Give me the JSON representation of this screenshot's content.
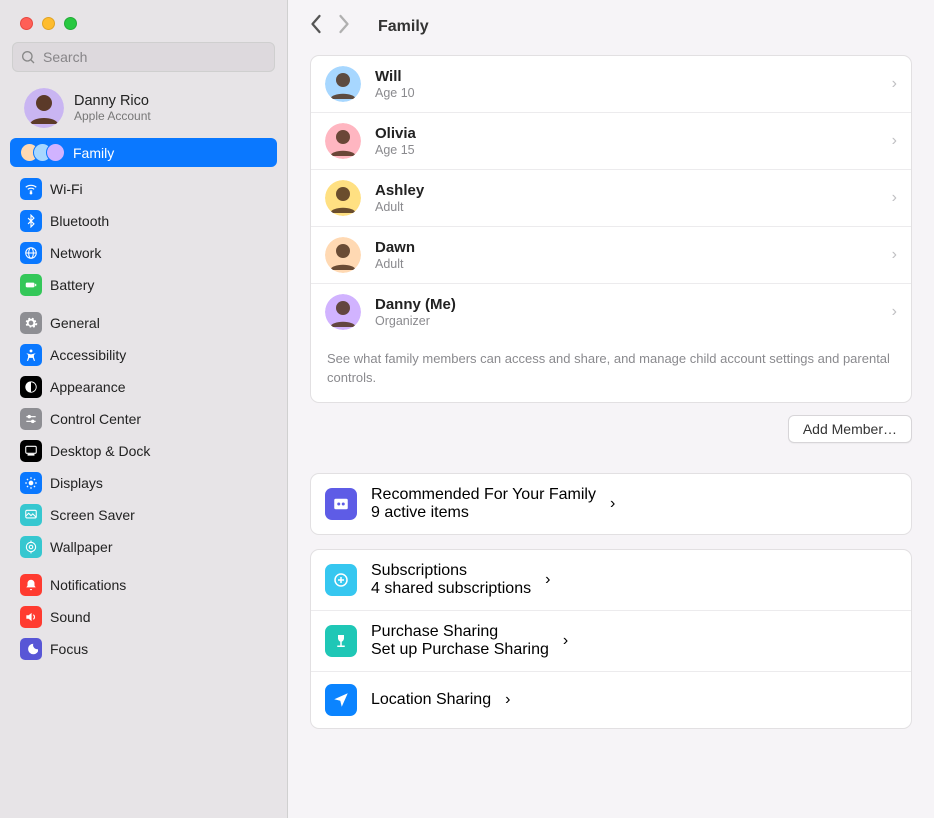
{
  "search": {
    "placeholder": "Search"
  },
  "account": {
    "name": "Danny Rico",
    "subtitle": "Apple Account"
  },
  "sidebar": {
    "itemsTop": [
      {
        "label": "Family",
        "icon": "family-icon",
        "selected": true
      }
    ],
    "group1": [
      {
        "label": "Wi-Fi",
        "icon": "wifi-icon",
        "bg": "#0a78ff"
      },
      {
        "label": "Bluetooth",
        "icon": "bluetooth-icon",
        "bg": "#0a78ff"
      },
      {
        "label": "Network",
        "icon": "network-icon",
        "bg": "#0a78ff"
      },
      {
        "label": "Battery",
        "icon": "battery-icon",
        "bg": "#34c759"
      }
    ],
    "group2": [
      {
        "label": "General",
        "icon": "gear-icon",
        "bg": "#8e8e93"
      },
      {
        "label": "Accessibility",
        "icon": "accessibility-icon",
        "bg": "#0a78ff"
      },
      {
        "label": "Appearance",
        "icon": "appearance-icon",
        "bg": "#000000"
      },
      {
        "label": "Control Center",
        "icon": "sliders-icon",
        "bg": "#8e8e93"
      },
      {
        "label": "Desktop & Dock",
        "icon": "dock-icon",
        "bg": "#000000"
      },
      {
        "label": "Displays",
        "icon": "display-icon",
        "bg": "#0a78ff"
      },
      {
        "label": "Screen Saver",
        "icon": "screensaver-icon",
        "bg": "#36c7d0"
      },
      {
        "label": "Wallpaper",
        "icon": "wallpaper-icon",
        "bg": "#36c7d0"
      }
    ],
    "group3": [
      {
        "label": "Notifications",
        "icon": "bell-icon",
        "bg": "#ff3b30"
      },
      {
        "label": "Sound",
        "icon": "sound-icon",
        "bg": "#ff3b30"
      },
      {
        "label": "Focus",
        "icon": "focus-icon",
        "bg": "#5856d6"
      }
    ]
  },
  "header": {
    "title": "Family"
  },
  "members": [
    {
      "name": "Will",
      "sub": "Age 10",
      "color": "#a7d7ff"
    },
    {
      "name": "Olivia",
      "sub": "Age 15",
      "color": "#ffb6c1"
    },
    {
      "name": "Ashley",
      "sub": "Adult",
      "color": "#ffe082"
    },
    {
      "name": "Dawn",
      "sub": "Adult",
      "color": "#ffd9b3"
    },
    {
      "name": "Danny (Me)",
      "sub": "Organizer",
      "color": "#d1b3ff"
    }
  ],
  "membersNote": "See what family members can access and share, and manage child account settings and parental controls.",
  "addMemberLabel": "Add Member…",
  "sections": {
    "recommend": {
      "title": "Recommended For Your Family",
      "sub": "9 active items",
      "bg": "#5e5ce6"
    },
    "subs": {
      "title": "Subscriptions",
      "sub": "4 shared subscriptions",
      "bg": "#36c7f0"
    },
    "purchase": {
      "title": "Purchase Sharing",
      "sub": "Set up Purchase Sharing",
      "bg": "#1fc7b6"
    },
    "location": {
      "title": "Location Sharing",
      "sub": "",
      "bg": "#0b84ff"
    }
  }
}
